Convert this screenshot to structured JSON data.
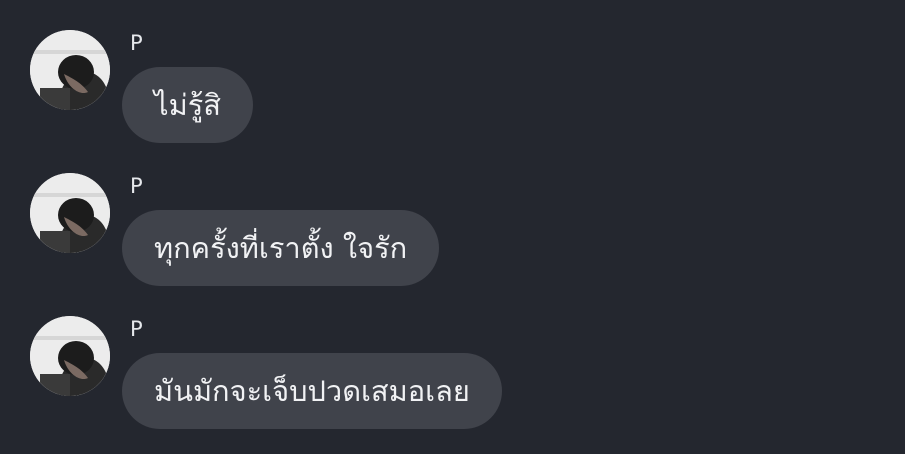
{
  "theme": {
    "background": "#24272f",
    "bubble": "#40434b",
    "text": "#f1f2f4"
  },
  "messages": [
    {
      "sender": "P",
      "avatar_icon": "profile-photo",
      "text": "ไม่รู้สิ"
    },
    {
      "sender": "P",
      "avatar_icon": "profile-photo",
      "text": "ทุกครั้งที่เราตั้ง ใจรัก"
    },
    {
      "sender": "P",
      "avatar_icon": "profile-photo",
      "text": "มันมักจะเจ็บปวดเสมอเลย"
    }
  ]
}
